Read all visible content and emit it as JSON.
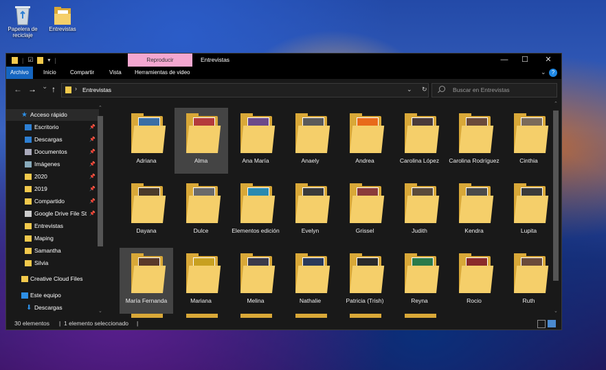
{
  "desktop": {
    "icons": [
      {
        "label": "Papelera de reciclaje",
        "icon": "recycle-bin-icon"
      },
      {
        "label": "Entrevistas",
        "icon": "folder-icon"
      }
    ]
  },
  "window": {
    "title": "Entrevistas",
    "context_tab": "Reproducir",
    "menu": [
      "Archivo",
      "Inicio",
      "Compartir",
      "Vista",
      "Herramientas de video"
    ],
    "help_label": "?",
    "controls": {
      "minimize": "—",
      "maximize": "☐",
      "close": "✕"
    }
  },
  "navigation": {
    "back": "←",
    "forward": "→",
    "recent": "⌄",
    "up": "↑",
    "breadcrumb_sep": "›",
    "address": "Entrevistas",
    "search_placeholder": "Buscar en Entrevistas"
  },
  "sidebar": {
    "quick_access": "Acceso rápido",
    "items": [
      {
        "label": "Escritorio",
        "pinned": true,
        "color": "#2d7fd3"
      },
      {
        "label": "Descargas",
        "pinned": true,
        "color": "#2d7fd3"
      },
      {
        "label": "Documentos",
        "pinned": true,
        "color": "#aab"
      },
      {
        "label": "Imágenes",
        "pinned": true,
        "color": "#8ab"
      },
      {
        "label": "2020",
        "pinned": true,
        "color": "#f2c94c"
      },
      {
        "label": "2019",
        "pinned": true,
        "color": "#f2c94c"
      },
      {
        "label": "Compartido",
        "pinned": true,
        "color": "#f2c94c"
      },
      {
        "label": "Google Drive File St",
        "pinned": true,
        "color": "#ccc"
      },
      {
        "label": "Entrevistas",
        "pinned": false,
        "color": "#f2c94c"
      },
      {
        "label": "Maping",
        "pinned": false,
        "color": "#f2c94c"
      },
      {
        "label": "Samantha",
        "pinned": false,
        "color": "#f2c94c"
      },
      {
        "label": "Silvia",
        "pinned": false,
        "color": "#f2c94c"
      }
    ],
    "creative_cloud": "Creative Cloud Files",
    "this_pc": "Este equipo",
    "this_pc_items": [
      "Descargas"
    ]
  },
  "folders": [
    {
      "name": "Adriana",
      "color": "#3a6ea5"
    },
    {
      "name": "Alma",
      "color": "#b43b3b",
      "selected": true
    },
    {
      "name": "Ana María",
      "color": "#6b4a8a"
    },
    {
      "name": "Anaely",
      "color": "#5a5a5a"
    },
    {
      "name": "Andrea",
      "color": "#e86a1a"
    },
    {
      "name": "Carolina López",
      "color": "#4a3a3a"
    },
    {
      "name": "Carolina Rodríguez",
      "color": "#6a4a3a"
    },
    {
      "name": "Cinthia",
      "color": "#7a6a5a"
    },
    {
      "name": "Dayana",
      "color": "#4a3a2a"
    },
    {
      "name": "Dulce",
      "color": "#6a6a6a"
    },
    {
      "name": "Elementos edición",
      "color": "#2a8ab0"
    },
    {
      "name": "Evelyn",
      "color": "#3a3a3a"
    },
    {
      "name": "Grissel",
      "color": "#8a3a3a"
    },
    {
      "name": "Judith",
      "color": "#5a4a3a"
    },
    {
      "name": "Kendra",
      "color": "#4a4a4a"
    },
    {
      "name": "Lupita",
      "color": "#3a3a3a"
    },
    {
      "name": "María Fernanda",
      "color": "#5a3a2a",
      "selected": true
    },
    {
      "name": "Mariana",
      "color": "#c8a020"
    },
    {
      "name": "Melina",
      "color": "#3a3a4a"
    },
    {
      "name": "Nathalie",
      "color": "#2a3a5a"
    },
    {
      "name": "Patricia (Trish)",
      "color": "#2a2a2a"
    },
    {
      "name": "Reyna",
      "color": "#2a7a4a"
    },
    {
      "name": "Rocio",
      "color": "#8a2a2a"
    },
    {
      "name": "Ruth",
      "color": "#6a4a3a"
    }
  ],
  "status": {
    "count": "30 elementos",
    "selection": "1 elemento seleccionado"
  }
}
